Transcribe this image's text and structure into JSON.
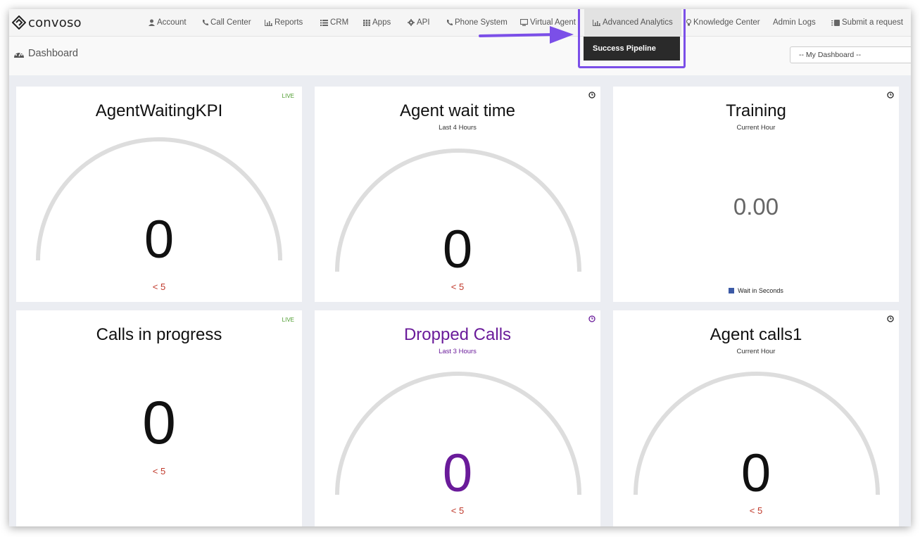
{
  "app": {
    "logo_text": "convoso"
  },
  "nav": {
    "items": [
      {
        "label": "Account",
        "icon": "user-icon"
      },
      {
        "label": "Call Center",
        "icon": "phone-icon"
      },
      {
        "label": "Reports",
        "icon": "bar-chart-icon"
      },
      {
        "label": "CRM",
        "icon": "list-icon"
      },
      {
        "label": "Apps",
        "icon": "grid-icon"
      },
      {
        "label": "API",
        "icon": "gear-icon"
      },
      {
        "label": "Phone System",
        "icon": "phone-icon"
      },
      {
        "label": "Virtual Agent",
        "icon": "monitor-icon"
      },
      {
        "label": "Advanced Analytics",
        "icon": "bar-chart-icon",
        "active": true
      },
      {
        "label": "Knowledge Center",
        "icon": "lightbulb-icon"
      },
      {
        "label": "Admin Logs",
        "icon": ""
      },
      {
        "label": "Submit a request",
        "icon": "ticket-icon"
      }
    ],
    "dropdown_item": "Success Pipeline"
  },
  "page": {
    "title": "Dashboard",
    "dashboard_select": "-- My Dashboard --"
  },
  "widgets": [
    {
      "title": "AgentWaitingKPI",
      "subtitle": "",
      "badge": "LIVE",
      "value": "0",
      "threshold": "< 5",
      "type": "gauge"
    },
    {
      "title": "Agent wait time",
      "subtitle": "Last 4 Hours",
      "badge": "",
      "value": "0",
      "threshold": "< 5",
      "type": "gauge"
    },
    {
      "title": "Training",
      "subtitle": "Current Hour",
      "badge": "",
      "value": "0.00",
      "threshold": "",
      "type": "number",
      "legend": "Wait in Seconds"
    },
    {
      "title": "Calls in progress",
      "subtitle": "",
      "badge": "LIVE",
      "value": "0",
      "threshold": "< 5",
      "type": "number"
    },
    {
      "title": "Dropped Calls",
      "subtitle": "Last 3 Hours",
      "badge": "",
      "value": "0",
      "threshold": "< 5",
      "type": "gauge"
    },
    {
      "title": "Agent calls1",
      "subtitle": "Current Hour",
      "badge": "",
      "value": "0",
      "threshold": "< 5",
      "type": "gauge"
    }
  ],
  "colors": {
    "highlight": "#7b4fe8",
    "live": "#4a9a2a",
    "threshold": "#c0392b",
    "dropped_calls": "#6a1b9a",
    "gauge_track": "#dddddd",
    "legend_swatch": "#3c5aa6"
  }
}
